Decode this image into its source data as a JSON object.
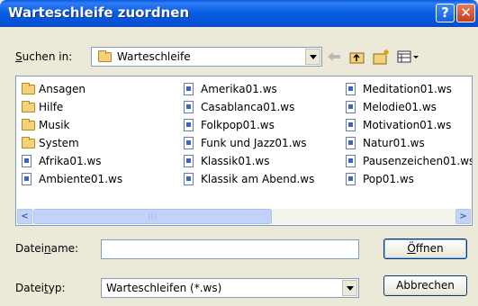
{
  "window": {
    "title": "Warteschleife zuordnen"
  },
  "lookin": {
    "label_pre": "",
    "label_u": "S",
    "label_post": "uchen in:",
    "value": "Warteschleife"
  },
  "files": {
    "col1": [
      "Ansagen",
      "Hilfe",
      "Musik",
      "System",
      "Afrika01.ws",
      "Ambiente01.ws"
    ],
    "col2": [
      "Amerika01.ws",
      "Casablanca01.ws",
      "Folkpop01.ws",
      "Funk und Jazz01.ws",
      "Klassik01.ws",
      "Klassik am Abend.ws"
    ],
    "col3": [
      "Meditation01.ws",
      "Melodie01.ws",
      "Motivation01.ws",
      "Natur01.ws",
      "Pausenzeichen01.ws",
      "Pop01.ws"
    ]
  },
  "filename": {
    "label_pre": "Datei",
    "label_u": "n",
    "label_post": "ame:",
    "value": ""
  },
  "filetype": {
    "label_pre": "Datei",
    "label_u": "t",
    "label_post": "yp:",
    "value": "Warteschleifen (*.ws)"
  },
  "buttons": {
    "open_u": "Ö",
    "open_post": "ffnen",
    "cancel": "Abbrechen"
  },
  "colors": {
    "titlebar": "#0b5fe3",
    "dialog_bg": "#ece9d8",
    "input_border": "#7f9db9"
  },
  "icons": [
    "help-icon",
    "close-icon",
    "folder-icon",
    "back-arrow-icon",
    "up-folder-icon",
    "new-folder-icon",
    "view-menu-icon",
    "file-icon"
  ]
}
